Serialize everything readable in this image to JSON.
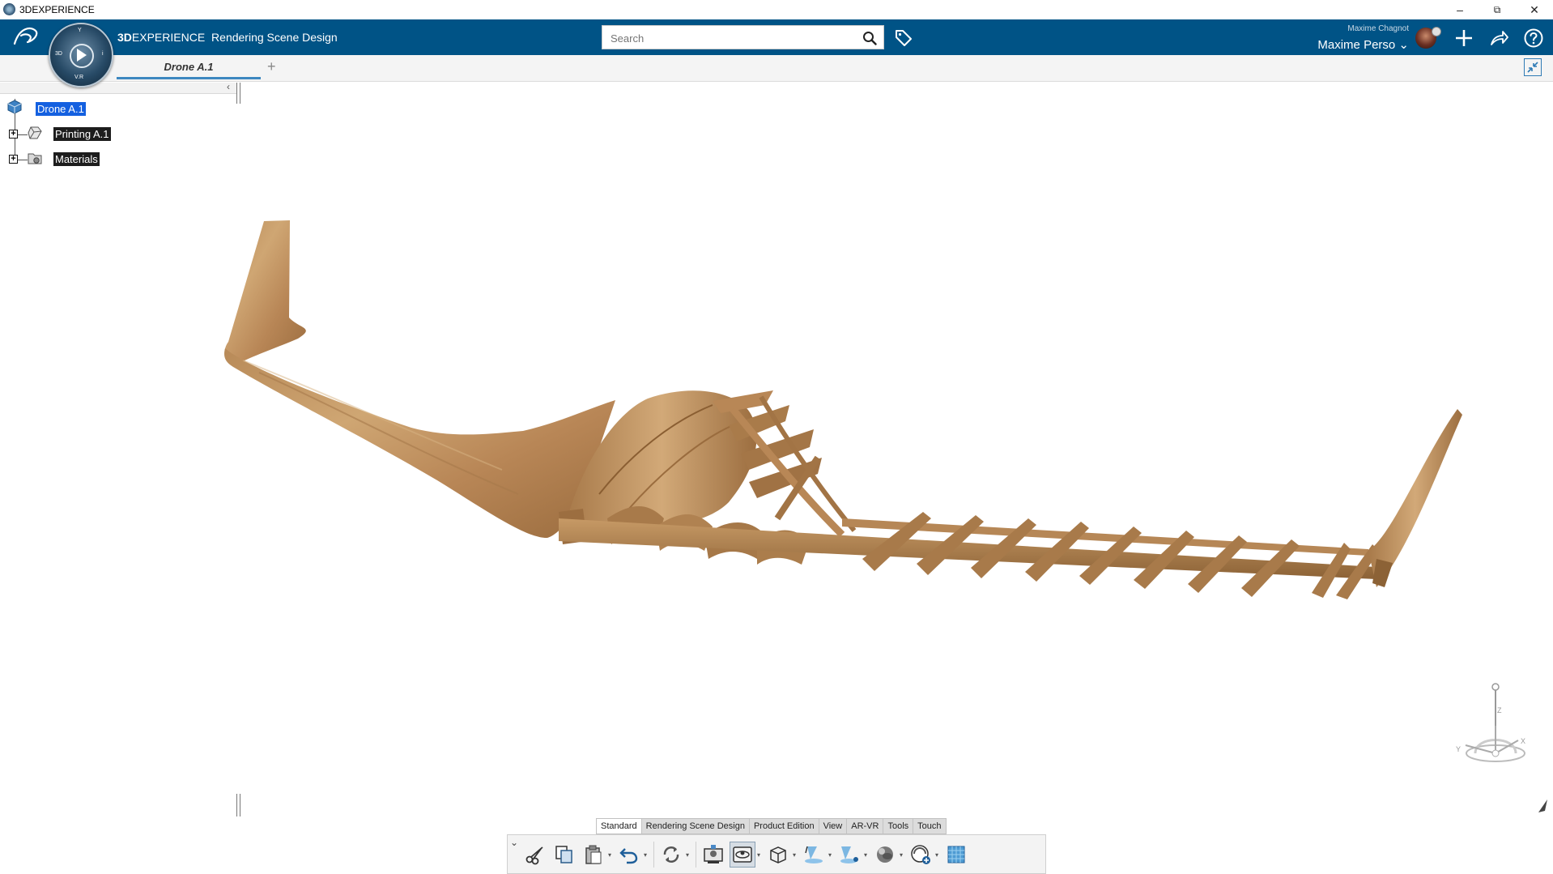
{
  "window": {
    "title": "3DEXPERIENCE",
    "minimize_glyph": "–",
    "maximize_glyph": "⧉",
    "close_glyph": "✕"
  },
  "header": {
    "brand": "3D",
    "brand_rest": "EXPERIENCE",
    "app_name": "Rendering Scene Design",
    "compass_labels": {
      "top": "Y",
      "left": "3D",
      "bottom": "V.R",
      "right": "i"
    },
    "search": {
      "placeholder": "Search",
      "value": ""
    },
    "user_top": "Maxime Chagnot",
    "user_name": "Maxime Perso",
    "user_chevron": "⌄",
    "icons": [
      "search-icon",
      "tag-icon",
      "avatar",
      "plus-icon",
      "share-icon",
      "help-icon"
    ]
  },
  "tabs": {
    "items": [
      {
        "label": "Drone A.1",
        "active": true
      }
    ],
    "add_label": "+"
  },
  "tree": {
    "collapse_glyph": "‹",
    "root": {
      "label": "Drone A.1",
      "icon": "product-icon",
      "selected": true
    },
    "children": [
      {
        "label": "Printing A.1",
        "icon": "part-icon",
        "expander": "+"
      },
      {
        "label": "Materials",
        "icon": "folder-icon",
        "expander": "+"
      }
    ]
  },
  "compass_axes": {
    "x": "X",
    "y": "Y",
    "z": "Z"
  },
  "section_tabs": [
    {
      "label": "Standard",
      "active": true
    },
    {
      "label": "Rendering Scene Design",
      "active": false
    },
    {
      "label": "Product Edition",
      "active": false
    },
    {
      "label": "View",
      "active": false
    },
    {
      "label": "AR-VR",
      "active": false
    },
    {
      "label": "Tools",
      "active": false
    },
    {
      "label": "Touch",
      "active": false
    }
  ],
  "action_bar": {
    "tools": [
      "cut-icon",
      "copy-icon",
      "paste-icon",
      "undo-icon",
      "update-icon",
      "render-icon",
      "environment-icon",
      "box-icon",
      "light-icon",
      "spotlight-icon",
      "material-icon",
      "add-appearance-icon",
      "texture-icon"
    ],
    "pressed_tool": "environment-icon",
    "dropdown_glyph": "▾",
    "expand_glyph": "⌄"
  },
  "colors": {
    "header_blue": "#005386",
    "selection_blue": "#1460e0",
    "wood_light": "#c9a070",
    "wood_dark": "#8c6236",
    "tab_underline": "#3d87c0"
  }
}
